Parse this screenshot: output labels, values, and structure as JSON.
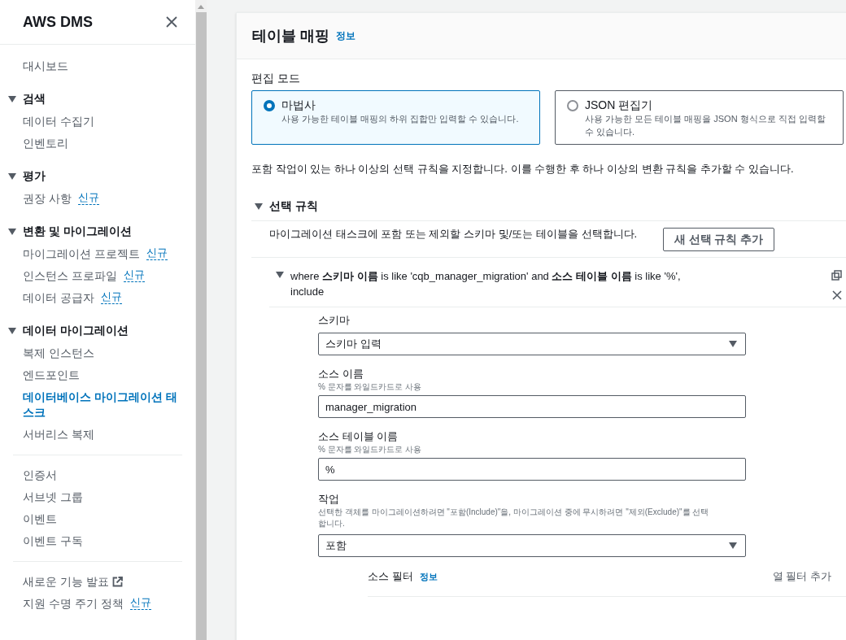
{
  "sidebar": {
    "title": "AWS DMS",
    "nav": [
      {
        "kind": "link",
        "label": "대시보드",
        "selected": false
      },
      {
        "kind": "section",
        "label": "검색",
        "expanded": true,
        "children": [
          {
            "label": "데이터 수집기",
            "selected": false
          },
          {
            "label": "인벤토리",
            "selected": false
          }
        ]
      },
      {
        "kind": "section",
        "label": "평가",
        "expanded": true,
        "children": [
          {
            "label": "권장 사항",
            "badge": "신규",
            "selected": false
          }
        ]
      },
      {
        "kind": "section",
        "label": "변환 및 마이그레이션",
        "expanded": true,
        "children": [
          {
            "label": "마이그레이션 프로젝트",
            "badge": "신규",
            "selected": false
          },
          {
            "label": "인스턴스 프로파일",
            "badge": "신규",
            "selected": false
          },
          {
            "label": "데이터 공급자",
            "badge": "신규",
            "selected": false
          }
        ]
      },
      {
        "kind": "section",
        "label": "데이터 마이그레이션",
        "expanded": true,
        "children": [
          {
            "label": "복제 인스턴스",
            "selected": false
          },
          {
            "label": "엔드포인트",
            "selected": false
          },
          {
            "label": "데이터베이스 마이그레이션 태스크",
            "selected": true
          },
          {
            "label": "서버리스 복제",
            "selected": false
          }
        ]
      },
      {
        "kind": "divider"
      },
      {
        "kind": "link",
        "label": "인증서",
        "selected": false
      },
      {
        "kind": "link",
        "label": "서브넷 그룹",
        "selected": false
      },
      {
        "kind": "link",
        "label": "이벤트",
        "selected": false
      },
      {
        "kind": "link",
        "label": "이벤트 구독",
        "selected": false
      },
      {
        "kind": "divider"
      },
      {
        "kind": "link",
        "label": "새로운 기능 발표",
        "external": true,
        "selected": false
      },
      {
        "kind": "link",
        "label": "지원 수명 주기 정책",
        "badge": "신규",
        "selected": false
      }
    ]
  },
  "panel": {
    "title": "테이블 매핑",
    "info": "정보",
    "edit_mode": {
      "label": "편집 모드",
      "options": [
        {
          "label": "마법사",
          "description": "사용 가능한 테이블 매핑의 하위 집합만 입력할 수 있습니다.",
          "selected": true
        },
        {
          "label": "JSON 편집기",
          "description": "사용 가능한 모든 테이블 매핑을 JSON 형식으로 직접 입력할 수 있습니다.",
          "selected": false
        }
      ]
    },
    "intro": "포함 작업이 있는 하나 이상의 선택 규칙을 지정합니다. 이를 수행한 후 하나 이상의 변환 규칙을 추가할 수 있습니다.",
    "selection_rules": {
      "title": "선택 규칙",
      "expanded": true,
      "description": "마이그레이션 태스크에 포함 또는 제외할 스키마 및/또는 테이블을 선택합니다.",
      "add_button": "새 선택 규칙 추가",
      "rules": [
        {
          "summary": "where **스키마 이름** is like 'cqb_manager_migration' and **소스 테이블 이름** is like '%', include",
          "expanded": true,
          "fields": [
            {
              "kind": "select",
              "label": "스키마",
              "value": "스키마 입력"
            },
            {
              "kind": "input",
              "label": "소스 이름",
              "hint": "% 문자를 와일드카드로 사용",
              "value": "manager_migration"
            },
            {
              "kind": "input",
              "label": "소스 테이블 이름",
              "hint": "% 문자를 와일드카드로 사용",
              "value": "%"
            },
            {
              "kind": "select",
              "label": "작업",
              "hint": "선택한 객체를 마이그레이션하려면 \"포함(Include)\"을, 마이그레이션 중에 무시하려면 \"제외(Exclude)\"를 선택합니다.",
              "value": "포함"
            }
          ],
          "source_filter": {
            "title": "소스 필터",
            "info": "정보",
            "add_button": "열 필터 추가"
          }
        }
      ]
    }
  }
}
